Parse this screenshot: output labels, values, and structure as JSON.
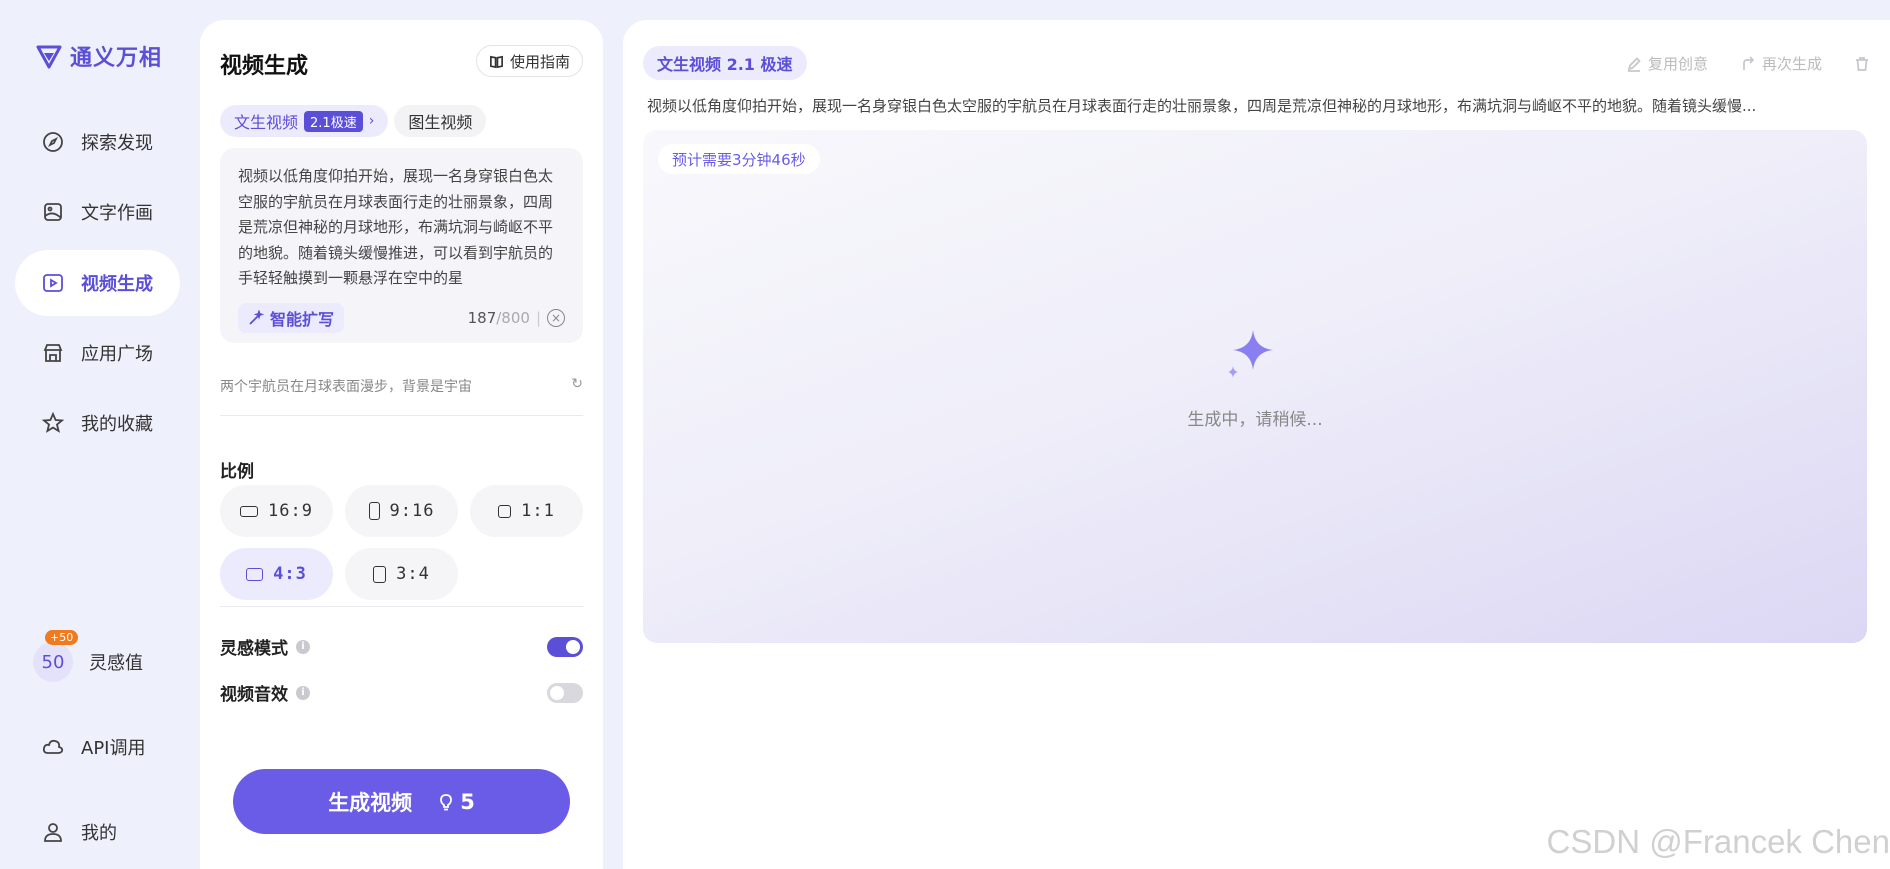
{
  "app": {
    "name": "通义万相"
  },
  "nav": {
    "items": [
      {
        "label": "探索发现",
        "icon": "compass-icon"
      },
      {
        "label": "文字作画",
        "icon": "image-icon"
      },
      {
        "label": "视频生成",
        "icon": "video-icon"
      },
      {
        "label": "应用广场",
        "icon": "store-icon"
      },
      {
        "label": "我的收藏",
        "icon": "star-icon"
      }
    ],
    "credits": {
      "value": "50",
      "badge": "+50",
      "label": "灵感值"
    },
    "api_label": "API调用",
    "me_label": "我的"
  },
  "panel": {
    "title": "视频生成",
    "guide_label": "使用指南",
    "tabs": {
      "text_to_video": "文生视频",
      "speed": "2.1极速",
      "image_to_video": "图生视频"
    },
    "prompt": "视频以低角度仰拍开始，展现一名身穿银白色太空服的宇航员在月球表面行走的壮丽景象，四周是荒凉但神秘的月球地形，布满坑洞与崎岖不平的地貌。随着镜头缓慢推进，可以看到宇航员的手轻轻触摸到一颗悬浮在空中的星",
    "expand_label": "智能扩写",
    "char_count": "187",
    "char_max": "/800",
    "suggestion": "两个宇航员在月球表面漫步，背景是宇宙",
    "ratio_label": "比例",
    "ratios": [
      "16:9",
      "9:16",
      "1:1",
      "4:3",
      "3:4"
    ],
    "selected_ratio": "4:3",
    "inspiration_mode": {
      "label": "灵感模式",
      "on": true
    },
    "sound_effect": {
      "label": "视频音效",
      "on": false
    },
    "generate_label": "生成视频",
    "generate_cost": "5"
  },
  "result": {
    "tag": "文生视频 2.1 极速",
    "reuse_label": "复用创意",
    "regen_label": "再次生成",
    "description": "视频以低角度仰拍开始，展现一名身穿银白色太空服的宇航员在月球表面行走的壮丽景象，四周是荒凉但神秘的月球地形，布满坑洞与崎岖不平的地貌。随着镜头缓慢...",
    "eta": "预计需要3分钟46秒",
    "loading": "生成中，请稍候..."
  },
  "watermark": "CSDN @Francek Chen",
  "colors": {
    "accent": "#5b4fd8",
    "button": "#6b5ce8",
    "badge": "#f07a1c"
  }
}
